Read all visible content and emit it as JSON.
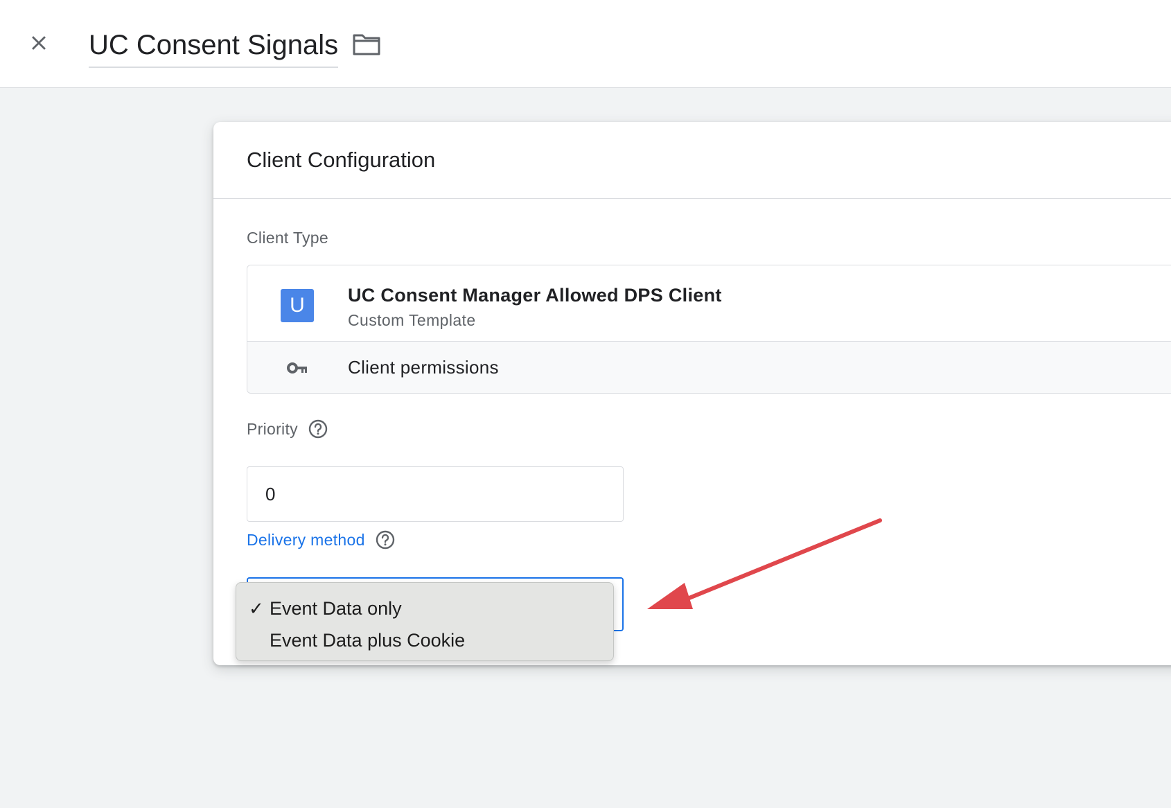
{
  "header": {
    "title": "UC Consent Signals",
    "close_icon": "close-icon",
    "folder_icon": "folder-icon"
  },
  "card": {
    "title": "Client Configuration",
    "client_type_label": "Client Type",
    "client": {
      "badge": "U",
      "badge_color": "#4a86e8",
      "name": "UC Consent Manager Allowed DPS Client",
      "subtitle": "Custom Template"
    },
    "permissions_label": "Client permissions",
    "priority": {
      "label": "Priority",
      "value": "0"
    },
    "delivery": {
      "label": "Delivery method",
      "label_color": "#1a73e8",
      "options": [
        {
          "label": "Event Data only",
          "selected": true,
          "check": "✓"
        },
        {
          "label": "Event Data plus Cookie",
          "selected": false,
          "check": ""
        }
      ]
    }
  },
  "annotation": {
    "arrow_color": "#e0474c"
  }
}
